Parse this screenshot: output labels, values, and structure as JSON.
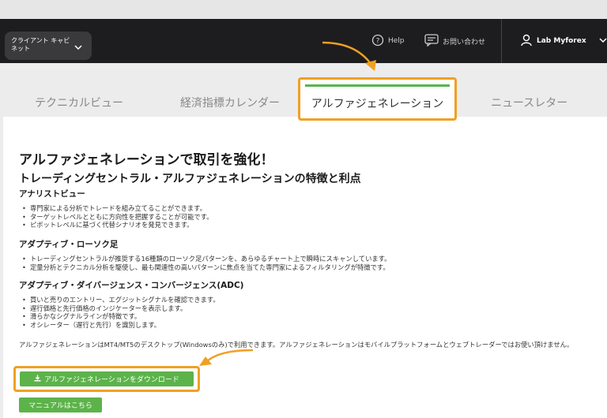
{
  "header": {
    "client_label": "クライアント キャビネット",
    "help_label": "Help",
    "contact_label": "お問い合わせ",
    "user_label": "Lab Myforex"
  },
  "tabs": [
    {
      "label": "テクニカルビュー",
      "active": false
    },
    {
      "label": "経済指標カレンダー",
      "active": false
    },
    {
      "label": "アルファジェネレーション",
      "active": true
    },
    {
      "label": "ニュースレター",
      "active": false
    }
  ],
  "main": {
    "title": "アルファジェネレーションで取引を強化！",
    "subtitle": "トレーディングセントラル・アルファジェネレーションの特徴と利点",
    "sections": [
      {
        "heading": "アナリストビュー",
        "items": [
          "専門家による分析でトレードを組み立てることができます。",
          "ターゲットレベルとともに方向性を把握することが可能です。",
          "ピボットレベルに基づく代替シナリオを発見できます。"
        ]
      },
      {
        "heading": "アダプティブ・ローソク足",
        "items": [
          "トレーディングセントラルが推奨する16種類のローソク足パターンを、あらゆるチャート上で瞬時にスキャンしています。",
          "定量分析とテクニカル分析を駆使し、最も関連性の高いパターンに焦点を当てた専門家によるフィルタリングが特徴です。"
        ]
      },
      {
        "heading": "アダプティブ・ダイバージェンス・コンバージェンス(ADC)",
        "items": [
          "買いと売りのエントリー、エグジットシグナルを確認できます。",
          "遅行価格と先行価格のインジケーターを表示します。",
          "滑らかなシグナルラインが特徴です。",
          "オシレーター（遅行と先行）を識別します。"
        ]
      }
    ],
    "note": "アルファジェネレーションはMT4/MT5のデスクトップ(Windowsのみ)で利用できます。アルファジェネレーションはモバイルプラットフォームとウェブトレーダーではお使い頂けません。",
    "download_label": "アルファジェネレーションをダウンロード",
    "manual_label": "マニュアルはこちら"
  },
  "colors": {
    "accent_orange": "#f0a022",
    "button_green": "#5cb34a",
    "navbar_bg": "#1d1d1f"
  }
}
